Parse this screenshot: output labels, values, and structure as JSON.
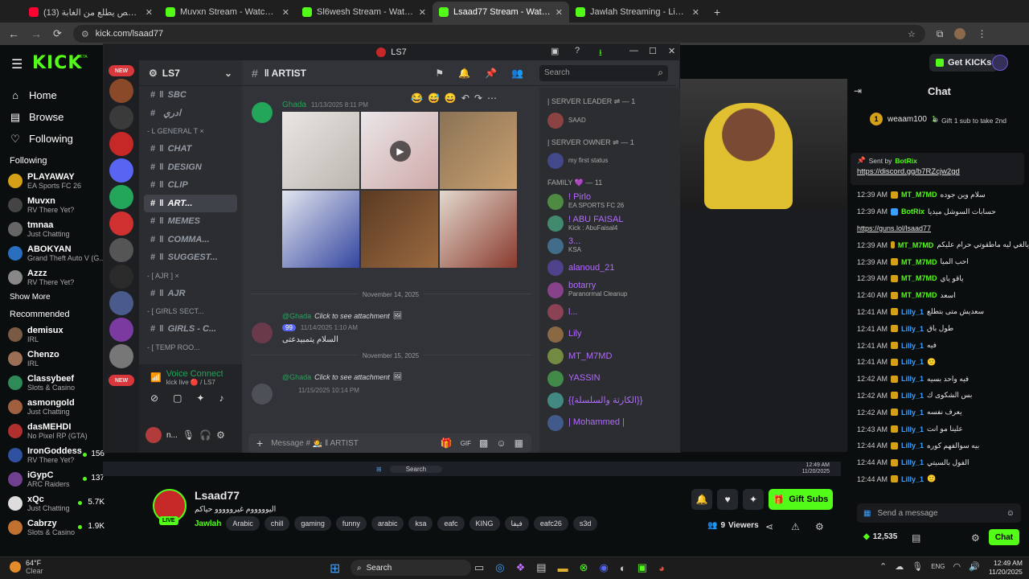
{
  "browser": {
    "tabs": [
      {
        "label": "(13) اخر شخص يطلع من الغابة",
        "color": "#ff0033",
        "active": false
      },
      {
        "label": "Muvxn Stream - Watch Live on",
        "color": "#53fc18",
        "active": false
      },
      {
        "label": "Sl6wesh Stream - Watch Live on",
        "color": "#53fc18",
        "active": false
      },
      {
        "label": "Lsaad77 Stream - Watch Live on",
        "color": "#53fc18",
        "active": true
      },
      {
        "label": "Jawlah Streaming - Live Stream",
        "color": "#53fc18",
        "active": false
      }
    ],
    "url": "kick.com/lsaad77"
  },
  "kick": {
    "logo": "KICK",
    "logo_badge": "BETA",
    "get_kicks": "Get KICKs",
    "nav": [
      {
        "label": "Home",
        "icon": "home-icon"
      },
      {
        "label": "Browse",
        "icon": "browse-icon"
      },
      {
        "label": "Following",
        "icon": "heart-icon"
      }
    ],
    "following_title": "Following",
    "following": [
      {
        "name": "PLAYAWAY",
        "game": "EA Sports FC 26",
        "color": "#d4a017",
        "viewers": ""
      },
      {
        "name": "Muvxn",
        "game": "RV There Yet?",
        "color": "#444",
        "viewers": ""
      },
      {
        "name": "tmnaa",
        "game": "Just Chatting",
        "color": "#666",
        "viewers": ""
      },
      {
        "name": "ABOKYAN",
        "game": "Grand Theft Auto V (G...",
        "color": "#2a6fbf",
        "viewers": ""
      },
      {
        "name": "Azzz",
        "game": "RV There Yet?",
        "color": "#888",
        "viewers": ""
      }
    ],
    "show_more": "Show More",
    "recommended_title": "Recommended",
    "recommended": [
      {
        "name": "demisux",
        "game": "IRL",
        "color": "#7a5a45",
        "viewers": ""
      },
      {
        "name": "Chenzo",
        "game": "IRL",
        "color": "#9b6f55",
        "viewers": ""
      },
      {
        "name": "Classybeef",
        "game": "Slots & Casino",
        "color": "#2e8b57",
        "viewers": ""
      },
      {
        "name": "asmongold",
        "game": "Just Chatting",
        "color": "#a06040",
        "viewers": ""
      },
      {
        "name": "dasMEHDI",
        "game": "No Pixel RP (GTA)",
        "color": "#b03030",
        "viewers": ""
      },
      {
        "name": "IronGoddess",
        "game": "RV There Yet?",
        "color": "#3050a0",
        "viewers": "156"
      },
      {
        "name": "iGypC",
        "game": "ARC Raiders",
        "color": "#704090",
        "viewers": "137"
      },
      {
        "name": "xQc",
        "game": "Just Chatting",
        "color": "#ddd",
        "viewers": "5.7K"
      },
      {
        "name": "Cabrzy",
        "game": "Slots & Casino",
        "color": "#c07030",
        "viewers": "1.9K"
      }
    ]
  },
  "discord": {
    "window_title": "LS7",
    "server_name": "LS7",
    "new_badge": "NEW",
    "new_badge2": "NEW",
    "channel_list": [
      {
        "type": "ch",
        "label": "SBC",
        "prefix": "‖",
        "active": false
      },
      {
        "type": "ch",
        "label": "ادري",
        "prefix": "",
        "active": false
      },
      {
        "type": "cat",
        "label": "- L GENERAL T ×"
      },
      {
        "type": "ch",
        "label": "CHAT",
        "prefix": "‖",
        "active": false
      },
      {
        "type": "ch",
        "label": "DESIGN",
        "prefix": "‖",
        "active": false
      },
      {
        "type": "ch",
        "label": "CLIP",
        "prefix": "‖",
        "active": false
      },
      {
        "type": "ch",
        "label": "ART...",
        "prefix": "‖",
        "active": true
      },
      {
        "type": "ch",
        "label": "MEMES",
        "prefix": "‖",
        "active": false
      },
      {
        "type": "ch",
        "label": "COMMA...",
        "prefix": "‖",
        "active": false
      },
      {
        "type": "ch",
        "label": "SUGGEST...",
        "prefix": "‖",
        "active": false
      },
      {
        "type": "cat",
        "label": "- [ AJR ] ×"
      },
      {
        "type": "ch",
        "label": "AJR",
        "prefix": "‖",
        "active": false
      },
      {
        "type": "cat",
        "label": "- [ GIRLS SECT..."
      },
      {
        "type": "ch",
        "label": "GIRLS - C...",
        "prefix": "‖",
        "active": false
      },
      {
        "type": "cat",
        "label": "- [ TEMP ROO..."
      }
    ],
    "voice": {
      "title": "Voice Connected",
      "sub": "kick live 🔴 / LS7"
    },
    "user_name": "n...",
    "channel_title": "‖ ARTIST",
    "search_placeholder": "Search",
    "message1_author": "Ghada",
    "message1_time": "11/13/2025 8:11 PM",
    "date1": "November 14, 2025",
    "reply1": "@Ghada",
    "click_attachment": "Click to see attachment",
    "message2_time": "11/14/2025 1:10 AM",
    "message2_badge": "99",
    "message2_text": "السلام يتمبيدعتى",
    "date2": "November 15, 2025",
    "reply2": "@Ghada",
    "click_attachment2": "Click to see attachment",
    "message3_time": "11/15/2025 10:14 PM",
    "message_placeholder": "Message # 🧑‍🎨 ‖ ARTIST",
    "member_sections": [
      {
        "title": "| SERVER LEADER ⇌ — 1",
        "members": [
          {
            "name": "",
            "status": "SAAD",
            "color": "#ffffff"
          }
        ]
      },
      {
        "title": "| SERVER OWNER ⇌ — 1",
        "members": [
          {
            "name": "",
            "status": "my first status",
            "color": "#ff5c8a"
          }
        ]
      },
      {
        "title": "FAMILY 💜 — 11",
        "members": [
          {
            "name": "! Pirlo",
            "status": "EA SPORTS FC 26",
            "color": "#b36bff"
          },
          {
            "name": "! ABU FAISAL",
            "status": "Kick : AbuFaisal4",
            "color": "#b36bff"
          },
          {
            "name": "3...",
            "status": "KSA",
            "color": "#b36bff"
          },
          {
            "name": "alanoud_21",
            "status": "",
            "color": "#b36bff"
          },
          {
            "name": "botarry",
            "status": "Paranormal Cleanup",
            "color": "#b36bff"
          },
          {
            "name": "l...",
            "status": "",
            "color": "#b36bff"
          },
          {
            "name": "Lily",
            "status": "",
            "color": "#b36bff"
          },
          {
            "name": "MT_M7MD",
            "status": "",
            "color": "#b36bff"
          },
          {
            "name": "YASSIN",
            "status": "",
            "color": "#b36bff"
          },
          {
            "name": "{{الكارثة والسلسلة}}",
            "status": "",
            "color": "#b36bff"
          },
          {
            "name": "| Mohammed |",
            "status": "",
            "color": "#b36bff"
          }
        ]
      }
    ]
  },
  "chat": {
    "title": "Chat",
    "top_gifter": "weaam100",
    "top_gifter_count": "1",
    "gift_prompt": "Gift 1 sub to take 2nd",
    "pinned_by": "Sent by",
    "pinned_bot": "BotRix",
    "pinned_link": "https://discord.gg/b7RZcjw2gd",
    "messages": [
      {
        "time": "12:39 AM",
        "user": "MT_M7MD",
        "color": "#53fc18",
        "text": "سلام وين جوده"
      },
      {
        "time": "12:39 AM",
        "user": "BotRix",
        "color": "#53fc18",
        "text": "حسابات السوشل ميديا"
      },
      {
        "time": "",
        "user": "",
        "color": "#fff",
        "text": "https://guns.lol/lsaad77"
      },
      {
        "time": "12:39 AM",
        "user": "MT_M7MD",
        "color": "#53fc18",
        "text": "يالغي ليه ماطقوتي حرام عليكم"
      },
      {
        "time": "12:39 AM",
        "user": "MT_M7MD",
        "color": "#53fc18",
        "text": "احب الميا"
      },
      {
        "time": "12:39 AM",
        "user": "MT_M7MD",
        "color": "#53fc18",
        "text": "ياقو ياي"
      },
      {
        "time": "12:40 AM",
        "user": "MT_M7MD",
        "color": "#53fc18",
        "text": "اسعد"
      },
      {
        "time": "12:41 AM",
        "user": "Lilly_1",
        "color": "#3aa0ff",
        "text": "سعديش متى بتطلع"
      },
      {
        "time": "12:41 AM",
        "user": "Lilly_1",
        "color": "#3aa0ff",
        "text": "طول باق"
      },
      {
        "time": "12:41 AM",
        "user": "Lilly_1",
        "color": "#3aa0ff",
        "text": "فيه"
      },
      {
        "time": "12:41 AM",
        "user": "Lilly_1",
        "color": "#3aa0ff",
        "text": "🙂"
      },
      {
        "time": "12:42 AM",
        "user": "Lilly_1",
        "color": "#3aa0ff",
        "text": "فيه واحد بسيه"
      },
      {
        "time": "12:42 AM",
        "user": "Lilly_1",
        "color": "#3aa0ff",
        "text": "بس الشكوى ك"
      },
      {
        "time": "12:42 AM",
        "user": "Lilly_1",
        "color": "#3aa0ff",
        "text": "يعرف نفسه"
      },
      {
        "time": "12:43 AM",
        "user": "Lilly_1",
        "color": "#3aa0ff",
        "text": "علينا مو انت"
      },
      {
        "time": "12:44 AM",
        "user": "Lilly_1",
        "color": "#3aa0ff",
        "text": "بيه سوالفهم كوره"
      },
      {
        "time": "12:44 AM",
        "user": "Lilly_1",
        "color": "#3aa0ff",
        "text": "الفول بالسيتي"
      },
      {
        "time": "12:44 AM",
        "user": "Lilly_1",
        "color": "#3aa0ff",
        "text": "🙂"
      }
    ],
    "input_placeholder": "Send a message",
    "kicks_balance": "12,535",
    "chat_button": "Chat"
  },
  "streamer": {
    "name": "Lsaad77",
    "title": "اليوووووم غيرووووو حياكم",
    "category": "Jawlah",
    "tags": [
      "Arabic",
      "chill",
      "gaming",
      "funny",
      "arabic",
      "ksa",
      "eafc",
      "KING",
      "فيفا",
      "eafc26",
      "s3d"
    ],
    "live_label": "LIVE",
    "viewers": "9",
    "viewers_label": "Viewers",
    "gift_subs": "Gift Subs"
  },
  "windows": {
    "weather_temp": "64°F",
    "weather_desc": "Clear",
    "search": "Search",
    "time": "12:49 AM",
    "date": "11/20/2025",
    "inner_search": "Search",
    "inner_time": "12:49 AM",
    "inner_date": "11/20/2025",
    "lang": "ENG"
  },
  "colors": {
    "kick_green": "#53fc18",
    "discord_bg": "#313338",
    "discord_blurple": "#5865f2"
  }
}
